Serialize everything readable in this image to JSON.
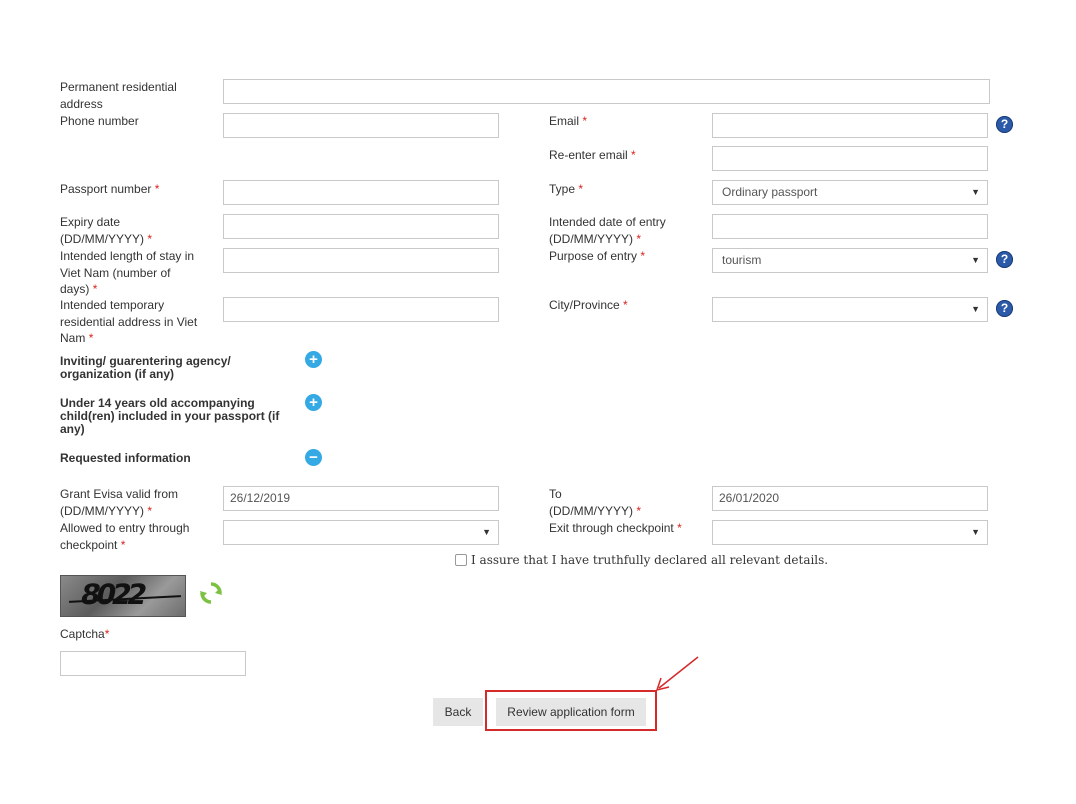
{
  "form": {
    "permanent_address": {
      "label": "Permanent residential address",
      "value": ""
    },
    "phone": {
      "label": "Phone number",
      "value": ""
    },
    "email": {
      "label": "Email",
      "required": "*",
      "value": ""
    },
    "reenter_email": {
      "label": "Re-enter email",
      "required": "*",
      "value": ""
    },
    "passport_number": {
      "label": "Passport number",
      "required": "*",
      "value": ""
    },
    "passport_type": {
      "label": "Type",
      "required": "*",
      "value": "Ordinary passport"
    },
    "expiry_date": {
      "label_line1": "Expiry date",
      "label_line2": "(DD/MM/YYYY)",
      "required": "*",
      "value": ""
    },
    "entry_date": {
      "label_line1": "Intended date of entry",
      "label_line2": "(DD/MM/YYYY)",
      "required": "*",
      "value": ""
    },
    "length_of_stay": {
      "label_line1": "Intended length of stay in",
      "label_line2": "Viet Nam (number of",
      "label_line3": "days)",
      "required": "*",
      "value": ""
    },
    "purpose": {
      "label": "Purpose of entry",
      "required": "*",
      "value": "tourism"
    },
    "temp_address": {
      "label_line1": "Intended temporary",
      "label_line2": "residential address in Viet",
      "label_line3": "Nam",
      "required": "*",
      "value": ""
    },
    "city": {
      "label": "City/Province",
      "required": "*",
      "value": ""
    },
    "inviting_agency": {
      "label_line1": "Inviting/ guarentering agency/",
      "label_line2": "organization (if any)"
    },
    "children": {
      "label_line1": "Under 14 years old accompanying",
      "label_line2": "child(ren) included in your passport (if",
      "label_line3": "any)"
    },
    "requested_info": {
      "label": "Requested information"
    },
    "valid_from": {
      "label_line1": "Grant Evisa valid from",
      "label_line2": "(DD/MM/YYYY)",
      "required": "*",
      "value": "26/12/2019"
    },
    "valid_to": {
      "label_line1": "To",
      "label_line2": "(DD/MM/YYYY)",
      "required": "*",
      "value": "26/01/2020"
    },
    "entry_checkpoint": {
      "label_line1": "Allowed to entry through",
      "label_line2": "checkpoint",
      "required": "*",
      "value": ""
    },
    "exit_checkpoint": {
      "label": "Exit through checkpoint",
      "required": "*",
      "value": ""
    },
    "assurance": "I assure that I have truthfully declared all relevant details.",
    "captcha": {
      "label": "Captcha",
      "required": "*",
      "image_text": "8022",
      "value": ""
    }
  },
  "buttons": {
    "back": "Back",
    "review": "Review application form"
  },
  "icons": {
    "help": "?",
    "plus": "+",
    "minus": "−",
    "caret": "▼"
  },
  "colors": {
    "required": "#d9231d",
    "help_icon": "#2b5aa8",
    "toggle_icon": "#35a9e4",
    "highlight": "#d42a2a",
    "refresh": "#7cc142"
  }
}
